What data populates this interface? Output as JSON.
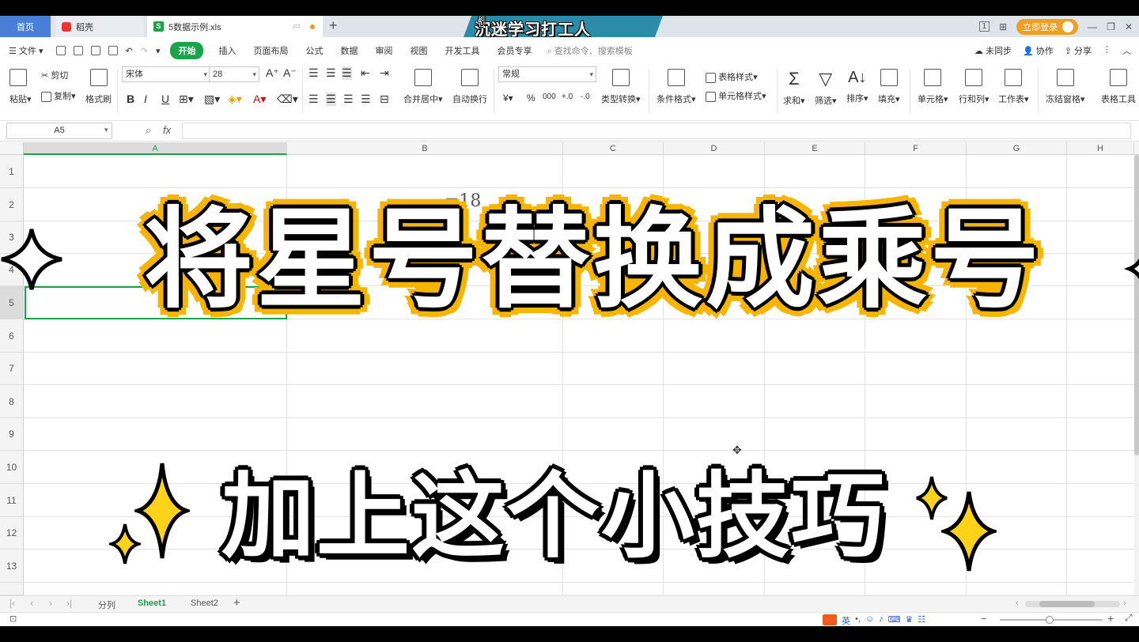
{
  "tabs": {
    "home": "首页",
    "daoke": "稻壳",
    "doc": "5数据示例.xls",
    "new_tab": "+"
  },
  "banner": {
    "text": "沉迷学习打工人"
  },
  "titlebar_right": {
    "login": "立即登录",
    "page_indicator": "1"
  },
  "menu": {
    "file": "文件",
    "items": [
      "开始",
      "插入",
      "页面布局",
      "公式",
      "数据",
      "审阅",
      "视图",
      "开发工具",
      "会员专享"
    ],
    "search_placeholder": "查找命令、搜索模板",
    "right": [
      "未同步",
      "协作",
      "分享"
    ]
  },
  "ribbon": {
    "paste": "粘贴",
    "cut": "剪切",
    "copy": "复制",
    "format_painter": "格式刷",
    "font_name": "宋体",
    "font_size": "28",
    "merge_center": "合并居中",
    "wrap_text": "自动换行",
    "number_format": "常规",
    "type_convert": "类型转换",
    "cond_format": "条件格式",
    "table_style": "表格样式",
    "cell_style": "单元格样式",
    "sum": "求和",
    "filter": "筛选",
    "sort": "排序",
    "fill": "填充",
    "cells": "单元格",
    "rows_cols": "行和列",
    "worksheet": "工作表",
    "freeze": "冻结窗格",
    "table_tools": "表格工具"
  },
  "formula_bar": {
    "name_box": "A5",
    "fx": "fx",
    "formula": ""
  },
  "grid": {
    "columns": [
      "A",
      "B",
      "C",
      "D",
      "E",
      "F",
      "G",
      "H"
    ],
    "active_column": "A",
    "rows": [
      "1",
      "2",
      "3",
      "4",
      "5",
      "6",
      "7",
      "8",
      "9",
      "10",
      "11",
      "12",
      "13"
    ],
    "active_row": "5",
    "visible_cell_text": "=18"
  },
  "sheets": {
    "tabs": [
      "分列",
      "Sheet1",
      "Sheet2"
    ],
    "active": "Sheet1",
    "add": "+"
  },
  "overlay": {
    "title": "将星号替换成乘号",
    "subtitle": "加上这个小技巧",
    "accent_color": "#f7b500",
    "spark_color": "#ffd21a"
  },
  "status": {
    "ime_lang": "英"
  }
}
